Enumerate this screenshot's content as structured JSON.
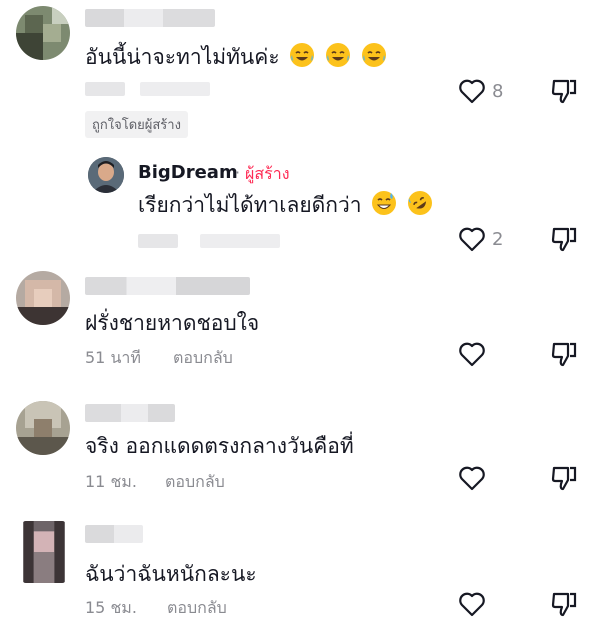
{
  "comments": [
    {
      "text": "อันนี้น่าจะทาไม่ทันค่ะ",
      "like_count": "8",
      "creator_liked_label": "ถูกใจโดยผู้สร้าง",
      "emojis": [
        "face-with-tears-of-joy-icon",
        "face-with-tears-of-joy-icon",
        "face-with-tears-of-joy-icon"
      ]
    },
    {
      "text": "ฝรั่งชายหาดชอบใจ",
      "time": "51 นาที",
      "reply_label": "ตอบกลับ"
    },
    {
      "text": "จริง ออกแดดตรงกลางวันคือที่",
      "time": "11 ชม.",
      "reply_label": "ตอบกลับ"
    },
    {
      "text": "ฉันว่าฉันหนักละนะ",
      "time": "15 ชม.",
      "reply_label": "ตอบกลับ"
    }
  ],
  "reply": {
    "author": "BigDream",
    "separator": "·",
    "creator_tag": "ผู้สร้าง",
    "text": "เรียกว่าไม่ได้ทาเลยดีกว่า",
    "like_count": "2",
    "emojis": [
      "grinning-face-with-sweat-icon",
      "rolling-on-floor-laughing-icon"
    ]
  },
  "colors": {
    "text": "#161823",
    "secondary": "#8a8b91",
    "creator_accent": "#fe2c55",
    "badge_bg": "#f1f1f2"
  }
}
